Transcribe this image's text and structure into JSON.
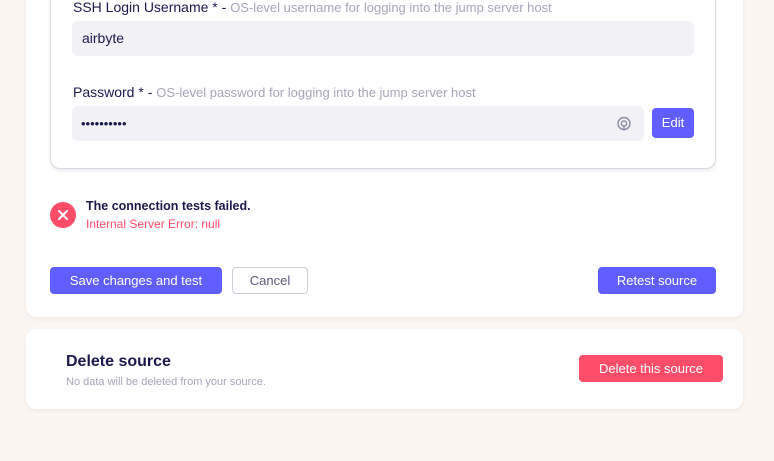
{
  "ssh_form": {
    "username_label": "SSH Login Username * - ",
    "username_hint": "OS-level username for logging into the jump server host",
    "username_value": "airbyte",
    "password_label": "Password * - ",
    "password_hint": "OS-level password for logging into the jump server host",
    "password_value": "••••••••••",
    "edit_label": "Edit",
    "password_icon": "eye-icon"
  },
  "status": {
    "title": "The connection tests failed.",
    "message": "Internal Server Error: null",
    "icon": "error-x-icon"
  },
  "actions": {
    "save_label": "Save changes and test",
    "cancel_label": "Cancel",
    "retest_label": "Retest source"
  },
  "delete_section": {
    "title": "Delete source",
    "subtitle": "No data will be deleted from your source.",
    "button_label": "Delete this source"
  },
  "colors": {
    "primary": "#615eff",
    "danger": "#ff4d6a",
    "background": "#fbf6f1",
    "text": "#1a194d",
    "muted": "#a6a6b9"
  }
}
